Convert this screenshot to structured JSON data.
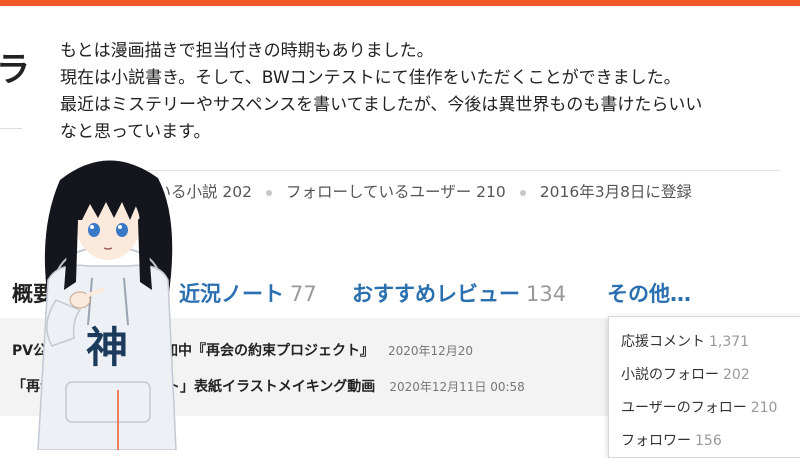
{
  "profile": {
    "name_fragment": "ラ",
    "bio_lines": [
      "もとは漫画描きで担当付きの時期もありました。",
      "現在は小説書き。そして、BWコンテストにて佳作をいただくことができました。",
      "最近はミステリーやサスペンスを書いてましたが、今後は異世界ものも書けたらいい",
      "なと思っています。"
    ]
  },
  "stats": {
    "novels_label": "ている小説 202",
    "following_users": "フォローしているユーザー 210",
    "registered": "2016年3月8日に登録"
  },
  "tabs": [
    {
      "label": "概要",
      "count": ""
    },
    {
      "label": "近況ノート",
      "count": "77"
    },
    {
      "label": "おすすめレビュー",
      "count": "134"
    },
    {
      "label": "その他…",
      "count": ""
    }
  ],
  "feed": [
    {
      "title": "PV公開 カクヨムコン参加中『再会の約束プロジェクト』",
      "date": "2020年12月20"
    },
    {
      "title": "「再会の約束プロジェクト」表紙イラストメイキング動画",
      "date": "2020年12月11日 00:58"
    }
  ],
  "dropdown": [
    {
      "label": "応援コメント",
      "count": "1,371"
    },
    {
      "label": "小説のフォロー",
      "count": "202"
    },
    {
      "label": "ユーザーのフォロー",
      "count": "210"
    },
    {
      "label": "フォロワー",
      "count": "156"
    }
  ],
  "character": {
    "hoodie_text": "神",
    "colors": {
      "hair": "#15151d",
      "hoodie": "#edf0f5",
      "skin": "#fbeadc",
      "eyes": "#3a78c8",
      "accent": "#f05a28"
    }
  }
}
